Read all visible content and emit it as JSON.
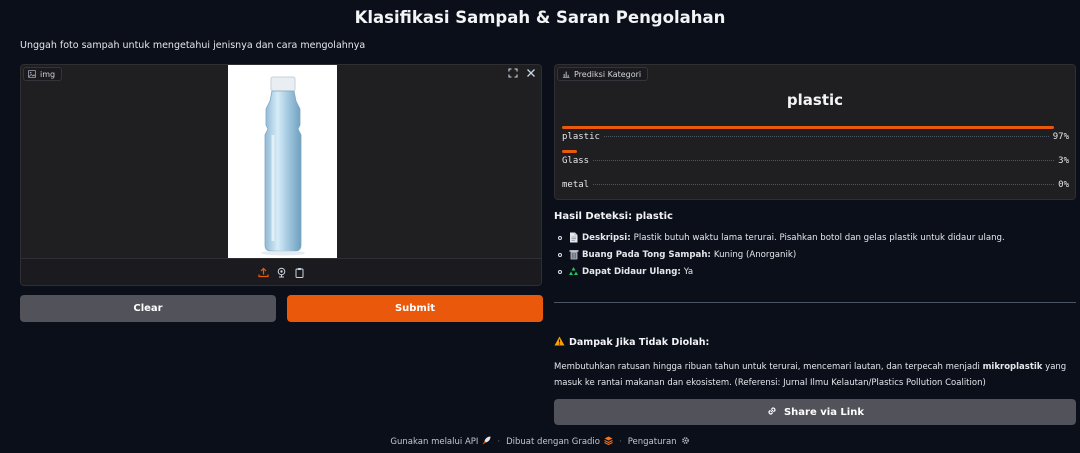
{
  "header": {
    "title": "Klasifikasi Sampah & Saran Pengolahan",
    "subtitle": "Unggah foto sampah untuk mengetahui jenisnya dan cara mengolahnya"
  },
  "image_input": {
    "label": "img",
    "label_icon": "image-icon",
    "toolbar_icons": [
      "upload-icon",
      "webcam-icon",
      "clipboard-icon"
    ],
    "corner_icons": [
      "fullscreen-icon",
      "close-icon"
    ]
  },
  "buttons": {
    "clear": "Clear",
    "submit": "Submit",
    "share": "Share via Link"
  },
  "prediction": {
    "label": "Prediksi Kategori",
    "top_label": "plastic",
    "items": [
      {
        "name": "plastic",
        "percent": "97%",
        "value": 0.97
      },
      {
        "name": "Glass",
        "percent": "3%",
        "value": 0.03
      },
      {
        "name": "metal",
        "percent": "0%",
        "value": 0.0
      }
    ]
  },
  "result": {
    "title": "Hasil Deteksi: plastic",
    "items": [
      {
        "icon": "document-icon",
        "label": "Deskripsi:",
        "text": "Plastik butuh waktu lama terurai. Pisahkan botol dan gelas plastik untuk didaur ulang."
      },
      {
        "icon": "trash-icon",
        "label": "Buang Pada Tong Sampah:",
        "text": "Kuning (Anorganik)"
      },
      {
        "icon": "recycle-icon",
        "label": "Dapat Didaur Ulang:",
        "text": "Ya"
      }
    ]
  },
  "impact": {
    "title": "Dampak Jika Tidak Diolah:",
    "text_before": "Membutuhkan ratusan hingga ribuan tahun untuk terurai, mencemari lautan, dan terpecah menjadi ",
    "text_bold": "mikroplastik",
    "text_after": " yang masuk ke rantai makanan dan ekosistem. (Referensi: Jurnal Ilmu Kelautan/Plastics Pollution Coalition)"
  },
  "footer": {
    "api": "Gunakan melalui API",
    "gradio": "Dibuat dengan Gradio",
    "settings": "Pengaturan"
  },
  "colors": {
    "background": "#0b0f19",
    "panel": "#1f1f22",
    "accent": "#ea580c",
    "secondary_button": "#52525b"
  }
}
